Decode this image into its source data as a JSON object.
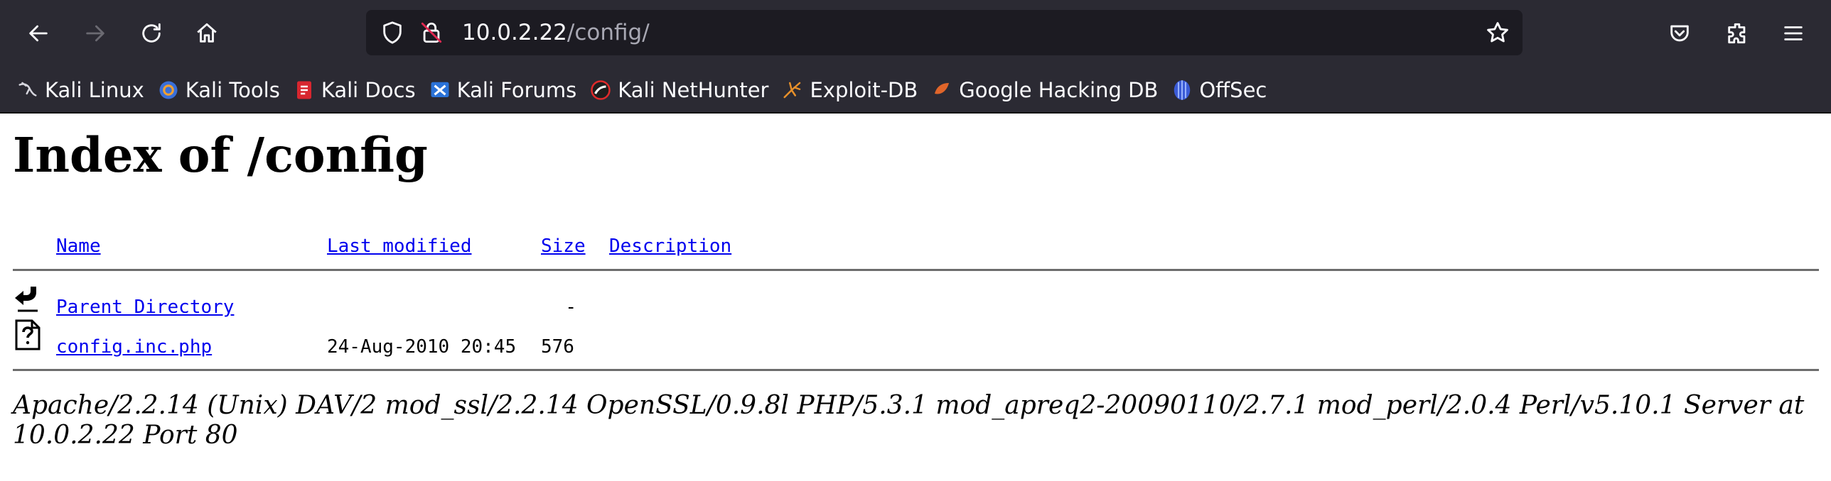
{
  "browser": {
    "url_host": "10.0.2.22",
    "url_path": "/config/",
    "bookmarks": [
      {
        "label": "Kali Linux",
        "icon": "kali-dragon-icon"
      },
      {
        "label": "Kali Tools",
        "icon": "kali-tools-icon"
      },
      {
        "label": "Kali Docs",
        "icon": "kali-docs-icon"
      },
      {
        "label": "Kali Forums",
        "icon": "kali-forums-icon"
      },
      {
        "label": "Kali NetHunter",
        "icon": "nethunter-icon"
      },
      {
        "label": "Exploit-DB",
        "icon": "exploit-db-icon"
      },
      {
        "label": "Google Hacking DB",
        "icon": "ghdb-icon"
      },
      {
        "label": "OffSec",
        "icon": "offsec-icon"
      }
    ]
  },
  "page": {
    "title": "Index of /config",
    "columns": {
      "name": "Name",
      "last_modified": "Last modified",
      "size": "Size",
      "description": "Description"
    },
    "rows": [
      {
        "name": "Parent Directory",
        "last_modified": "",
        "size": "-",
        "description": "",
        "icon": "back-arrow-icon"
      },
      {
        "name": "config.inc.php",
        "last_modified": "24-Aug-2010 20:45",
        "size": "576",
        "description": "",
        "icon": "unknown-file-icon"
      }
    ],
    "footer": "Apache/2.2.14 (Unix) DAV/2 mod_ssl/2.2.14 OpenSSL/0.9.8l PHP/5.3.1 mod_apreq2-20090110/2.7.1 mod_perl/2.0.4 Perl/v5.10.1 Server at 10.0.2.22 Port 80"
  }
}
